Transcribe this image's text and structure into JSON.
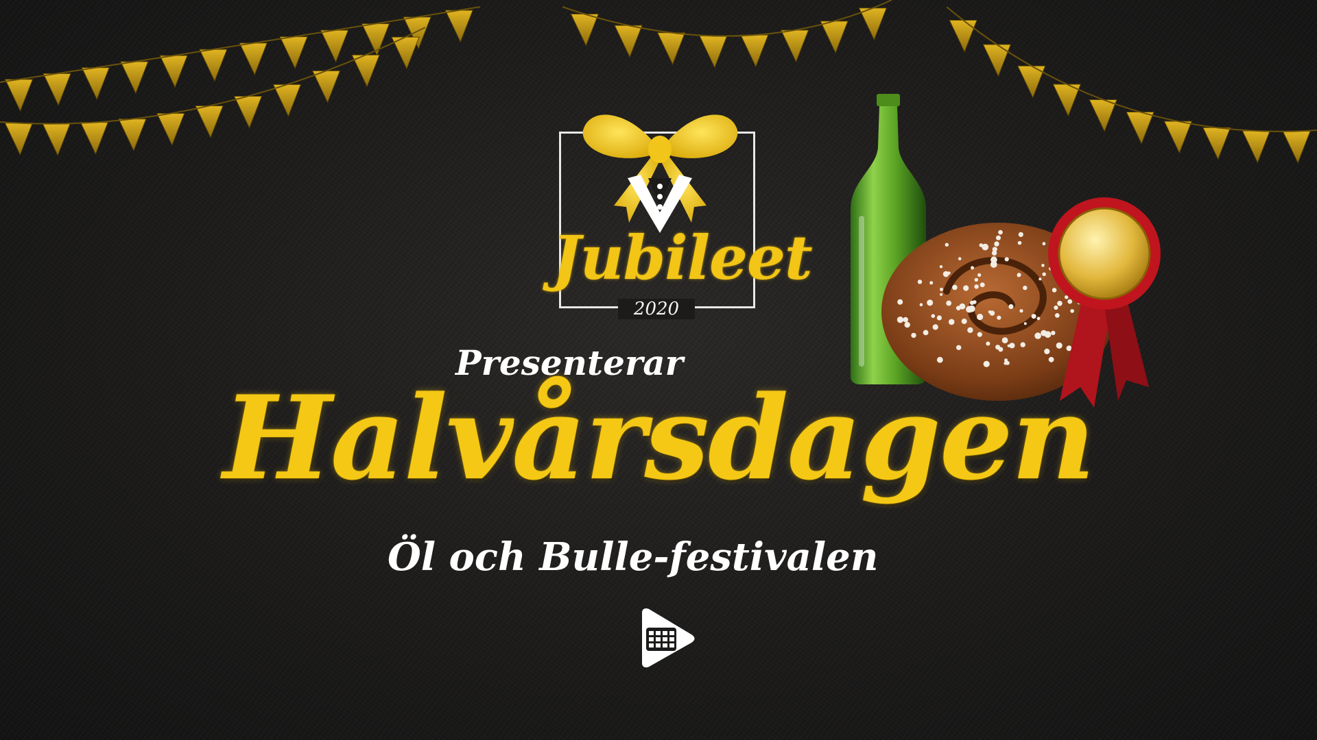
{
  "logo": {
    "name": "Jubileet",
    "year": "2020",
    "accent_color": "#f2c516"
  },
  "presents_text": "Presenterar",
  "headline": "Halvårsdagen",
  "subtitle": "Öl och Bulle-festivalen",
  "icons": {
    "bow": "bow-tie-icon",
    "bottle": "beer-bottle-icon",
    "bun": "cinnamon-bun-icon",
    "medal": "rosette-medal-icon",
    "brand": "play-calendar-icon"
  },
  "colors": {
    "background": "#1b1a19",
    "gold": "#f4c814",
    "white": "#ffffff"
  }
}
